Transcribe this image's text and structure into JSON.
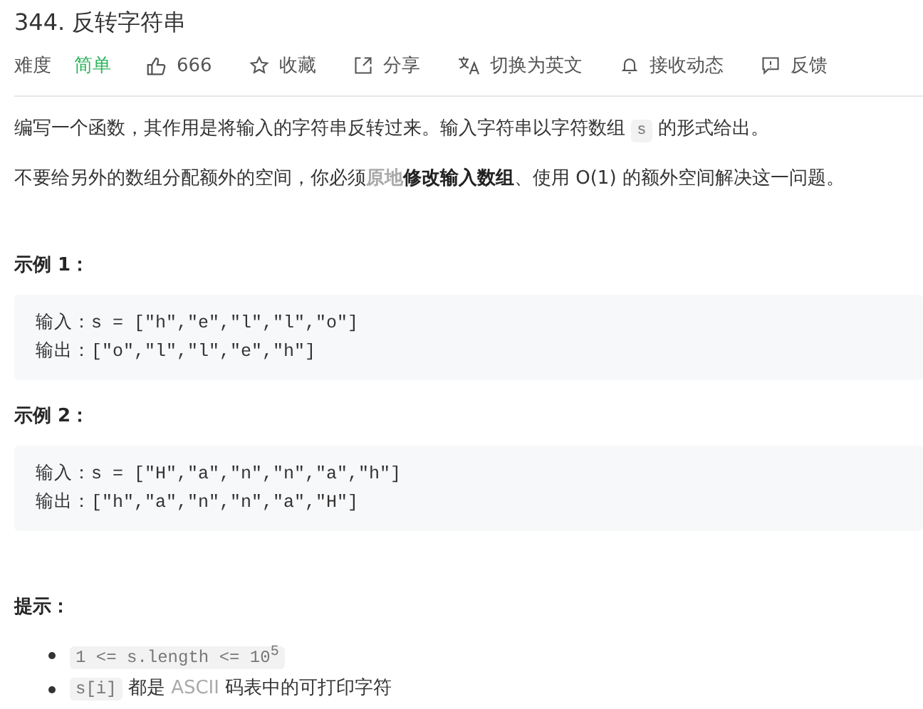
{
  "title": "344. 反转字符串",
  "meta": {
    "difficulty_label": "难度",
    "difficulty": "简单",
    "likes": "666",
    "actions": [
      {
        "kind": "star",
        "label": "收藏"
      },
      {
        "kind": "share",
        "label": "分享"
      },
      {
        "kind": "translate",
        "label": "切换为英文"
      },
      {
        "kind": "bell",
        "label": "接收动态"
      },
      {
        "kind": "feedback",
        "label": "反馈"
      }
    ]
  },
  "description": [
    [
      {
        "kind": "text",
        "text": "编写一个函数，其作用是将输入的字符串反转过来。输入字符串以字符数组 "
      },
      {
        "kind": "code",
        "text": "s"
      },
      {
        "kind": "text",
        "text": " 的形式给出。"
      }
    ],
    [
      {
        "kind": "text",
        "text": "不要给另外的数组分配额外的空间，你必须"
      },
      {
        "kind": "link",
        "text": "原地"
      },
      {
        "kind": "bold",
        "text": "修改输入数组"
      },
      {
        "kind": "text",
        "text": "、使用 O(1) 的额外空间解决这一问题。"
      }
    ]
  ],
  "examples": [
    {
      "heading": "示例 1：",
      "lines": [
        "输入：s = [\"h\",\"e\",\"l\",\"l\",\"o\"]",
        "输出：[\"o\",\"l\",\"l\",\"e\",\"h\"]"
      ]
    },
    {
      "heading": "示例 2：",
      "lines": [
        "输入：s = [\"H\",\"a\",\"n\",\"n\",\"a\",\"h\"]",
        "输出：[\"h\",\"a\",\"n\",\"n\",\"a\",\"H\"]"
      ]
    }
  ],
  "hints": {
    "heading": "提示：",
    "items": [
      [
        {
          "kind": "code",
          "text": "1 <= s.length <= 10$^{5}$"
        }
      ],
      [
        {
          "kind": "code",
          "text": "s[i]"
        },
        {
          "kind": "text",
          "text": " 都是 "
        },
        {
          "kind": "link",
          "text": "ASCII"
        },
        {
          "kind": "text",
          "text": " 码表中的可打印字符"
        }
      ]
    ]
  }
}
